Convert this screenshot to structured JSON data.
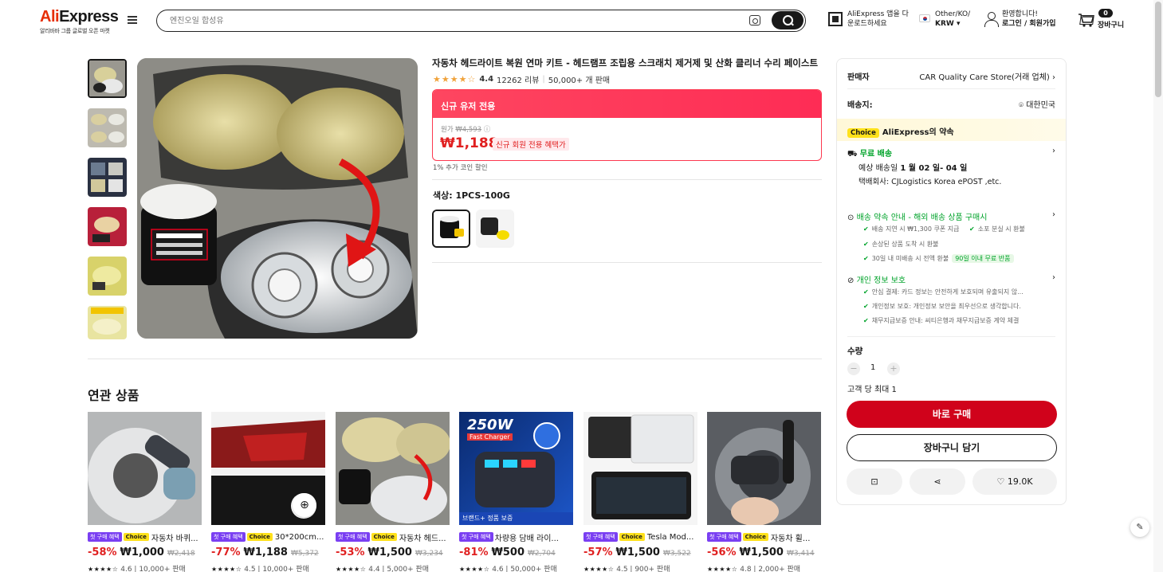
{
  "header": {
    "brand_ali": "Ali",
    "brand_express": "Express",
    "brand_sub": "알리바바 그룹 글로벌 오픈 마켓",
    "search_placeholder": "엔진오일 합성유",
    "app_line1": "AliExpress 앱을 다",
    "app_line2": "운로드하세요",
    "region_line1": "Other/KO/",
    "region_line2": "KRW ▾",
    "welcome_line1": "환영합니다!",
    "welcome_line2": "로그인 / 회원가입",
    "cart_count": "0",
    "cart_label": "장바구니"
  },
  "product": {
    "title": "자동차 헤드라이트 복원 연마 키트 - 헤드램프 조립용 스크래치 제거제 및 산화 클리너 수리 페이스트",
    "stars": "★★★★☆",
    "rating": "4.4",
    "reviews": "12262 리뷰",
    "sold": "50,000+ 개 판매",
    "deal_banner": "신규 유저 전용",
    "orig_label": "원가",
    "orig_price": "₩4,593",
    "price": "₩1,188",
    "price_tag": "신규 회원 전용 혜택가",
    "coin": "1% 추가 코인 할인",
    "color_label": "색상: 1PCS-100G"
  },
  "seller": {
    "label": "판매자",
    "name": "CAR Quality Care Store(거래 업체)",
    "ship_label": "배송지:",
    "ship_to": "대한민국",
    "choice_badge": "Choice",
    "choice_text": "AliExpress의 약속",
    "free_ship": "무료 배송",
    "eta_prefix": "예상 배송일 ",
    "eta": "1 월 02 일- 04 일",
    "carriers": "택배회사:   CJLogistics   Korea ePOST ,etc.",
    "promise_title": "배송 약속 안내 - 해외 배송 상품 구매시",
    "promise_items": [
      "배송 지연 시 ₩1,300 쿠폰 지급",
      "소포 분실 시 환불",
      "손상된 상품 도착 시 환불",
      "30일 내 미배송 시 전액 환불"
    ],
    "promise_badge": "90일 이내 무료 반품",
    "privacy_title": "개인 정보 보호",
    "privacy_items": [
      "안심 결제: 카드 정보는 안전하게 보호되며 유출되지 않...",
      "개인정보 보호: 개인정보 보안을 최우선으로 생각합니다.",
      "채무지급보증 안내: 씨티은행과 채무지급보증 계약 체결"
    ],
    "qty_label": "수량",
    "qty": "1",
    "qty_limit": "고객 당 최대 1",
    "buy_now": "바로 구매",
    "add_cart": "장바구니 담기",
    "wish_count": "19.0K"
  },
  "related": {
    "title": "연관 상품",
    "badge1": "첫 구매 혜택",
    "badge2": "Choice",
    "items": [
      {
        "title": "자동차 바퀴...",
        "pct": "-58%",
        "price": "₩1,000",
        "orig": "₩2,418",
        "stars": "★★★★☆",
        "rating": "4.6",
        "sold": "10,000+ 판매",
        "choice": true
      },
      {
        "title": "30*200cm...",
        "pct": "-77%",
        "price": "₩1,188",
        "orig": "₩5,372",
        "stars": "★★★★☆",
        "rating": "4.5",
        "sold": "10,000+ 판매",
        "choice": true
      },
      {
        "title": "자동차 헤드...",
        "pct": "-53%",
        "price": "₩1,500",
        "orig": "₩3,234",
        "stars": "★★★★☆",
        "rating": "4.4",
        "sold": "5,000+ 판매",
        "choice": true
      },
      {
        "title": "차량용 담배 라이...",
        "pct": "-81%",
        "price": "₩500",
        "orig": "₩2,704",
        "stars": "★★★★☆",
        "rating": "4.6",
        "sold": "50,000+ 판매",
        "choice": false
      },
      {
        "title": "Tesla Mod...",
        "pct": "-57%",
        "price": "₩1,500",
        "orig": "₩3,522",
        "stars": "★★★★☆",
        "rating": "4.5",
        "sold": "900+ 판매",
        "choice": true
      },
      {
        "title": "자동차 휠...",
        "pct": "-56%",
        "price": "₩1,500",
        "orig": "₩3,414",
        "stars": "★★★★☆",
        "rating": "4.8",
        "sold": "2,000+ 판매",
        "choice": true
      }
    ],
    "brand_tag": "브랜드+ 정품 보증",
    "img3_text": "250W",
    "img3_sub": "Fast Charger"
  },
  "colors": {
    "accent": "#e02020",
    "brand": "#e62e04",
    "choice": "#ffe11b",
    "green": "#00a32a"
  }
}
